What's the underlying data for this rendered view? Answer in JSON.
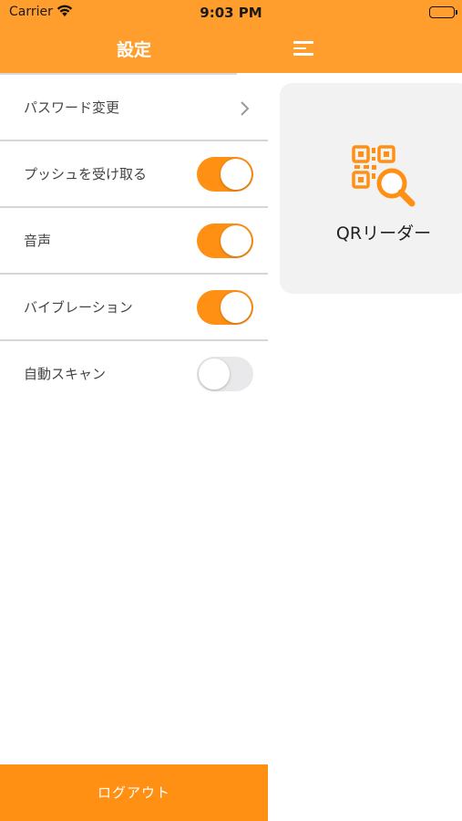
{
  "status_bar": {
    "carrier": "Carrier",
    "time": "9:03 PM"
  },
  "drawer": {
    "title": "設定",
    "items": [
      {
        "label": "パスワード変更",
        "type": "link"
      },
      {
        "label": "プッシュを受け取る",
        "type": "toggle",
        "on": true
      },
      {
        "label": "音声",
        "type": "toggle",
        "on": true
      },
      {
        "label": "バイブレーション",
        "type": "toggle",
        "on": true
      },
      {
        "label": "自動スキャン",
        "type": "toggle",
        "on": false
      }
    ],
    "logout_label": "ログアウト"
  },
  "main": {
    "menu_icon": "hamburger-menu-icon",
    "qr_card": {
      "icon": "qr-search-icon",
      "label": "QRリーダー"
    }
  },
  "colors": {
    "accent": "#FF9013",
    "header": "#FF9E2C",
    "card_bg": "#F2F2F2",
    "toggle_off": "#E9E9EB"
  }
}
